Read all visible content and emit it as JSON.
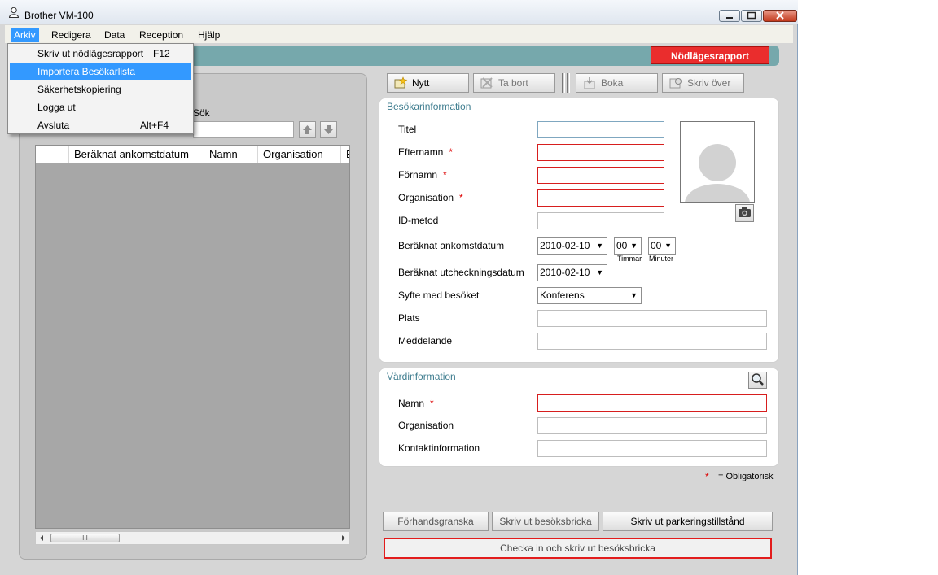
{
  "window": {
    "title": "Brother VM-100"
  },
  "menubar": {
    "items": [
      "Arkiv",
      "Redigera",
      "Data",
      "Reception",
      "Hjälp"
    ]
  },
  "file_menu": {
    "items": [
      {
        "label": "Skriv ut nödlägesrapport",
        "shortcut": "F12"
      },
      {
        "label": "Importera Besökarlista",
        "shortcut": ""
      },
      {
        "label": "Säkerhetskopiering",
        "shortcut": ""
      },
      {
        "label": "Logga ut",
        "shortcut": ""
      },
      {
        "label": "Avsluta",
        "shortcut": "Alt+F4"
      }
    ],
    "highlighted_index": 1
  },
  "header": {
    "emergency_button": "Nödlägesrapport"
  },
  "left": {
    "search_label": "Sök",
    "search_value": "",
    "columns": [
      "Beräknat ankomstdatum",
      "Namn",
      "Organisation",
      "B"
    ]
  },
  "toolbar": {
    "new": "Nytt",
    "delete": "Ta bort",
    "book": "Boka",
    "overwrite": "Skriv över"
  },
  "visitor": {
    "title": "Besökarinformation",
    "fields": {
      "titel": "Titel",
      "lastname": "Efternamn",
      "firstname": "Förnamn",
      "organisation": "Organisation",
      "id_method": "ID-metod",
      "arrival_date": "Beräknat ankomstdatum",
      "checkout_date": "Beräknat utcheckningsdatum",
      "purpose": "Syfte med besöket",
      "place": "Plats",
      "message": "Meddelande"
    },
    "values": {
      "arrival_date": "2010-02-10",
      "arrival_hours": "00",
      "arrival_minutes": "00",
      "checkout_date": "2010-02-10",
      "purpose": "Konferens"
    },
    "units": {
      "hours": "Timmar",
      "minutes": "Minuter"
    },
    "required_mark": "*"
  },
  "host": {
    "title": "Värdinformation",
    "fields": {
      "name": "Namn",
      "organisation": "Organisation",
      "contact": "Kontaktinformation"
    }
  },
  "legend": {
    "mark": "*",
    "text": "= Obligatorisk"
  },
  "bottom": {
    "preview": "Förhandsgranska",
    "print_badge": "Skriv ut besöksbricka",
    "print_parking": "Skriv ut parkeringstillstånd",
    "checkin": "Checka in och skriv ut besöksbricka"
  },
  "scroll": {
    "thumb_grip": "III"
  },
  "colors": {
    "accent": "#3399ff",
    "required": "#d71e1e",
    "teal": "#76a8ac",
    "emergency": "#ea2d2d"
  }
}
